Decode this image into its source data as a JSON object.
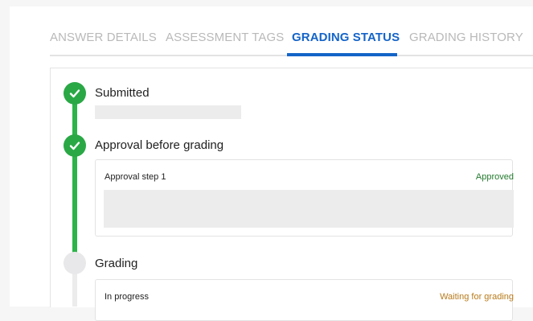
{
  "tabs": [
    {
      "label": "ANSWER DETAILS",
      "active": false
    },
    {
      "label": "ASSESSMENT TAGS",
      "active": false
    },
    {
      "label": "GRADING STATUS",
      "active": true
    },
    {
      "label": "GRADING HISTORY",
      "active": false
    }
  ],
  "colors": {
    "accent": "#1464c8",
    "complete": "#2aa846",
    "approved_text": "#237a2e",
    "waiting_text": "#b87a1a"
  },
  "icons": {
    "complete": "check-icon"
  },
  "steps": [
    {
      "title": "Submitted",
      "state": "complete"
    },
    {
      "title": "Approval before grading",
      "state": "complete",
      "card": {
        "label": "Approval step 1",
        "status": "Approved"
      }
    },
    {
      "title": "Grading",
      "state": "pending",
      "card": {
        "label": "In progress",
        "status": "Waiting for grading"
      }
    }
  ]
}
